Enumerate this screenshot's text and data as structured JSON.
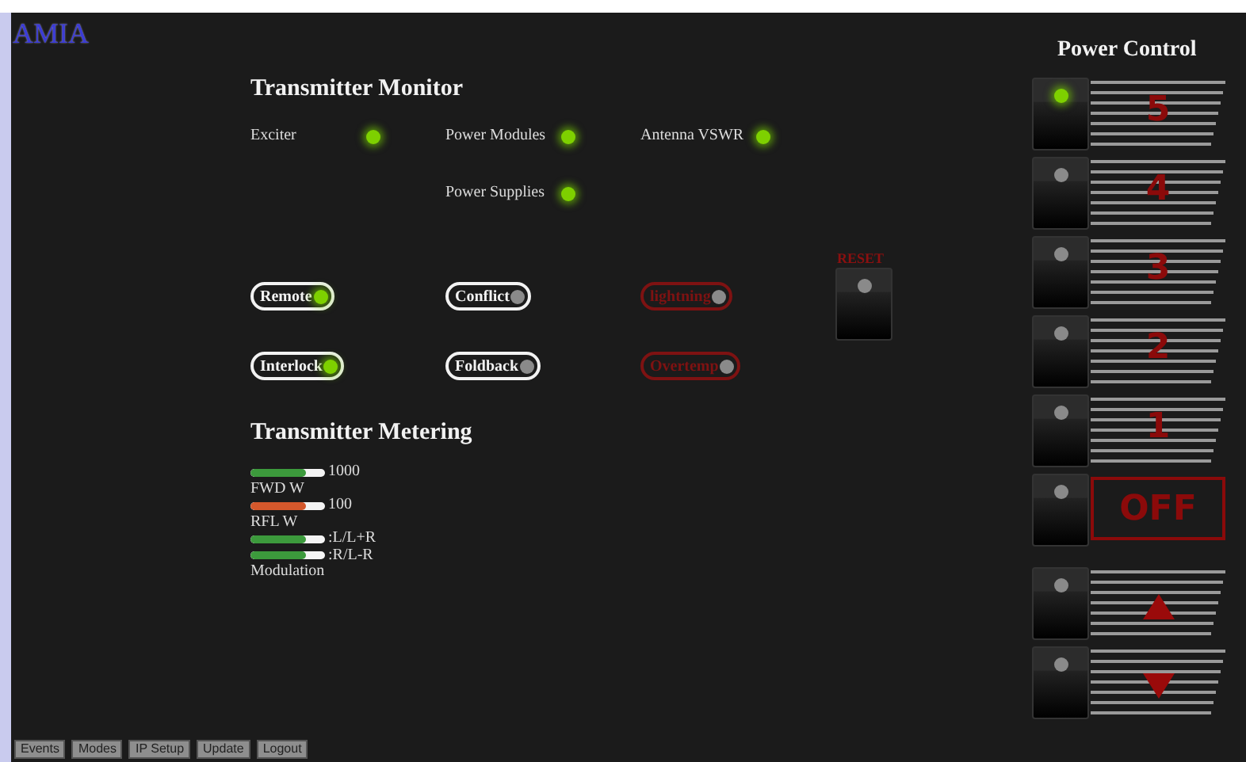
{
  "logo": "AMIA",
  "monitor": {
    "title": "Transmitter Monitor",
    "indicators": [
      {
        "label": "Exciter",
        "on": true
      },
      {
        "label": "Power Modules",
        "on": true
      },
      {
        "label": "Antenna VSWR",
        "on": true
      },
      {
        "label": "Power Supplies",
        "on": true
      }
    ]
  },
  "status": [
    {
      "kind": "status",
      "label": "Remote",
      "on": true
    },
    {
      "kind": "status",
      "label": "Conflict",
      "on": false
    },
    {
      "kind": "alarm",
      "label": "lightning",
      "on": false
    },
    {
      "kind": "status",
      "label": "Interlock",
      "on": true
    },
    {
      "kind": "status",
      "label": "Foldback",
      "on": false
    },
    {
      "kind": "alarm",
      "label": "Overtemp",
      "on": false
    }
  ],
  "reset": {
    "label": "RESET",
    "on": false
  },
  "metering": {
    "title": "Transmitter Metering",
    "meters": [
      {
        "level": 0.75,
        "color": "#3c9a3c",
        "reading": "1000",
        "label": "FWD W"
      },
      {
        "level": 0.75,
        "color": "#d4582c",
        "reading": "100",
        "label": "RFL W"
      },
      {
        "level": 0.75,
        "color": "#3c9a3c",
        "reading": ":L/L+R"
      },
      {
        "level": 0.75,
        "color": "#3c9a3c",
        "reading": ":R/L-R",
        "label": "Modulation"
      }
    ]
  },
  "power_control": {
    "title": "Power Control",
    "steps": [
      {
        "kind": "number",
        "label": "5",
        "selected": true
      },
      {
        "kind": "number",
        "label": "4",
        "selected": false
      },
      {
        "kind": "number",
        "label": "3",
        "selected": false
      },
      {
        "kind": "number",
        "label": "2",
        "selected": false
      },
      {
        "kind": "number",
        "label": "1",
        "selected": false
      },
      {
        "kind": "off",
        "label": "OFF",
        "selected": false
      },
      {
        "kind": "up",
        "selected": false
      },
      {
        "kind": "down",
        "selected": false
      }
    ]
  },
  "footer": [
    "Events",
    "Modes",
    "IP Setup",
    "Update",
    "Logout"
  ]
}
